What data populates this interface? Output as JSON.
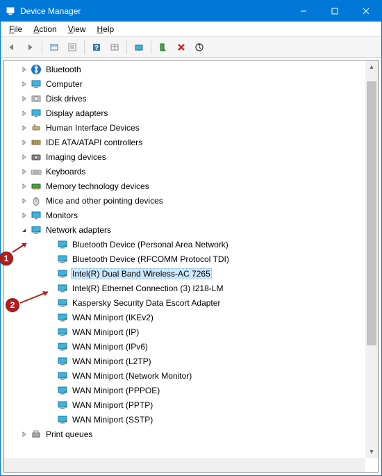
{
  "window": {
    "title": "Device Manager"
  },
  "menus": {
    "file": "File",
    "action": "Action",
    "view": "View",
    "help": "Help"
  },
  "toolbar_icons": [
    "nav-back-icon",
    "nav-forward-icon",
    "show-hidden-icon",
    "help-icon",
    "properties-icon",
    "update-driver-icon",
    "scan-hw-icon",
    "add-legacy-icon",
    "disable-icon",
    "uninstall-icon"
  ],
  "tree": {
    "categories": [
      {
        "icon": "bluetooth-icon",
        "label": "Bluetooth",
        "expanded": false
      },
      {
        "icon": "computer-icon",
        "label": "Computer",
        "expanded": false
      },
      {
        "icon": "disk-icon",
        "label": "Disk drives",
        "expanded": false
      },
      {
        "icon": "display-icon",
        "label": "Display adapters",
        "expanded": false
      },
      {
        "icon": "hid-icon",
        "label": "Human Interface Devices",
        "expanded": false
      },
      {
        "icon": "ide-icon",
        "label": "IDE ATA/ATAPI controllers",
        "expanded": false
      },
      {
        "icon": "imaging-icon",
        "label": "Imaging devices",
        "expanded": false
      },
      {
        "icon": "keyboard-icon",
        "label": "Keyboards",
        "expanded": false
      },
      {
        "icon": "memory-icon",
        "label": "Memory technology devices",
        "expanded": false
      },
      {
        "icon": "mouse-icon",
        "label": "Mice and other pointing devices",
        "expanded": false
      },
      {
        "icon": "monitor-icon",
        "label": "Monitors",
        "expanded": false
      },
      {
        "icon": "network-icon",
        "label": "Network adapters",
        "expanded": true,
        "children": [
          {
            "icon": "netcard-icon",
            "label": "Bluetooth Device (Personal Area Network)",
            "selected": false
          },
          {
            "icon": "netcard-icon",
            "label": "Bluetooth Device (RFCOMM Protocol TDI)",
            "selected": false
          },
          {
            "icon": "netcard-icon",
            "label": "Intel(R) Dual Band Wireless-AC 7265",
            "selected": true
          },
          {
            "icon": "netcard-icon",
            "label": "Intel(R) Ethernet Connection (3) I218-LM",
            "selected": false
          },
          {
            "icon": "netcard-icon",
            "label": "Kaspersky Security Data Escort Adapter",
            "selected": false
          },
          {
            "icon": "netcard-icon",
            "label": "WAN Miniport (IKEv2)",
            "selected": false
          },
          {
            "icon": "netcard-icon",
            "label": "WAN Miniport (IP)",
            "selected": false
          },
          {
            "icon": "netcard-icon",
            "label": "WAN Miniport (IPv6)",
            "selected": false
          },
          {
            "icon": "netcard-icon",
            "label": "WAN Miniport (L2TP)",
            "selected": false
          },
          {
            "icon": "netcard-icon",
            "label": "WAN Miniport (Network Monitor)",
            "selected": false
          },
          {
            "icon": "netcard-icon",
            "label": "WAN Miniport (PPPOE)",
            "selected": false
          },
          {
            "icon": "netcard-icon",
            "label": "WAN Miniport (PPTP)",
            "selected": false
          },
          {
            "icon": "netcard-icon",
            "label": "WAN Miniport (SSTP)",
            "selected": false
          }
        ]
      },
      {
        "icon": "printer-icon",
        "label": "Print queues",
        "expanded": false,
        "cutoff": true
      }
    ]
  },
  "callouts": {
    "c1": "1",
    "c2": "2"
  }
}
